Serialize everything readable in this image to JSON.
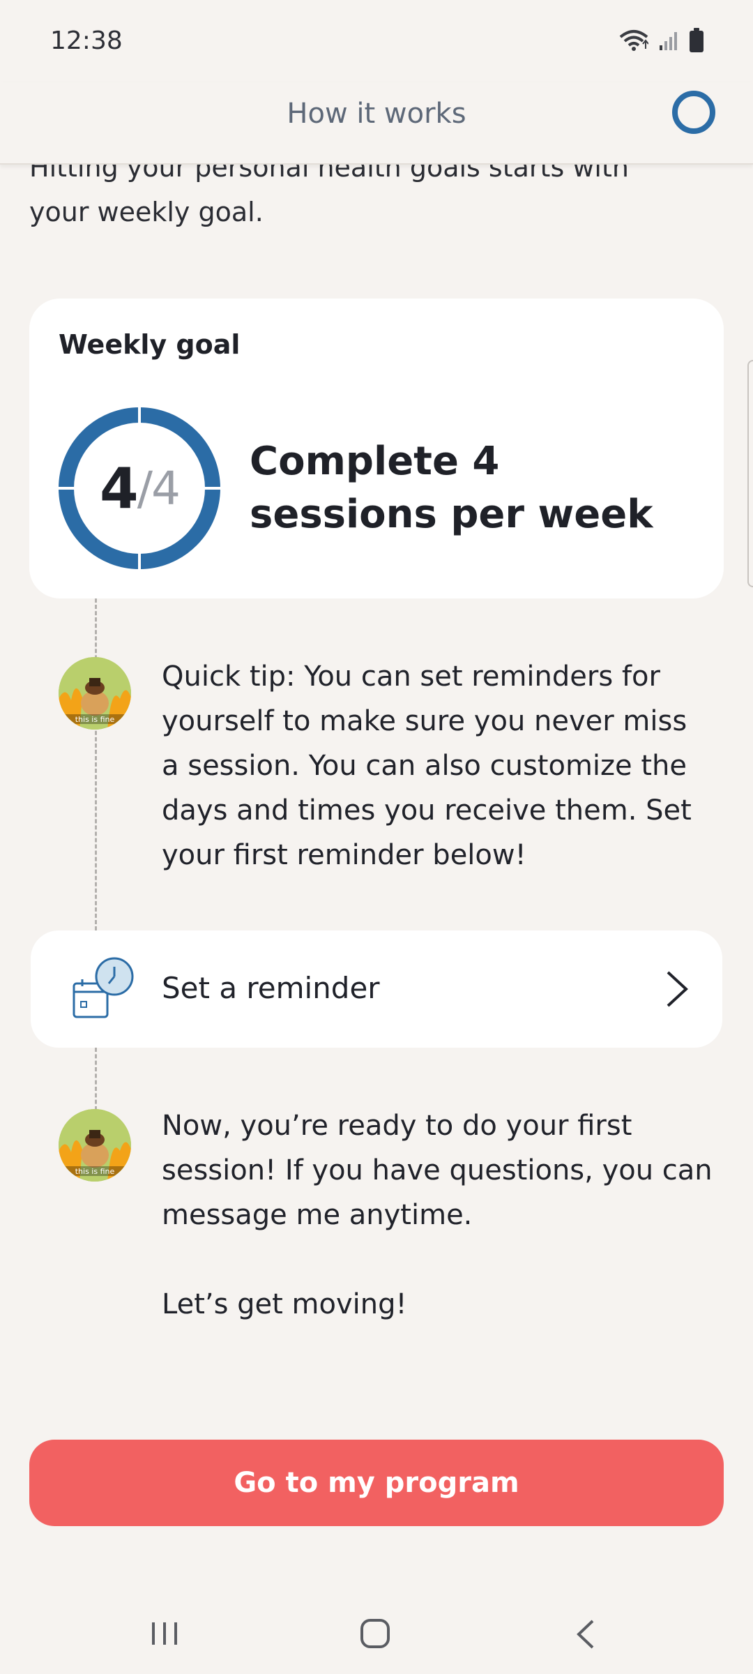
{
  "status_bar": {
    "time": "12:38"
  },
  "header": {
    "title": "How it works",
    "progress_icon": "ring-icon",
    "accent": "#2b6ca6"
  },
  "intro": {
    "line1": "Hitting your personal health goals starts with",
    "line2": "your weekly goal."
  },
  "goal_card": {
    "label": "Weekly goal",
    "completed": "4",
    "total": "/4",
    "progress_fraction": 1.0,
    "description": "Complete 4 sessions per week"
  },
  "tip1": {
    "avatar_icon": "coach-avatar-icon",
    "text": "Quick tip: You can set reminders for yourself to make sure you never miss a session. You can also customize the days and times you receive them. Set your first reminder below!"
  },
  "reminder": {
    "icon": "calendar-clock-icon",
    "label": "Set a reminder",
    "chevron_icon": "chevron-right-icon"
  },
  "tip2": {
    "avatar_icon": "coach-avatar-icon",
    "text": "Now, you’re ready to do your first session! If you have questions, you can message me anytime.",
    "text2": "Let’s get moving!"
  },
  "cta": {
    "label": "Go to my program",
    "color": "#f26161"
  },
  "nav": {
    "recents_icon": "recents-icon",
    "home_icon": "home-icon",
    "back_icon": "back-icon"
  }
}
